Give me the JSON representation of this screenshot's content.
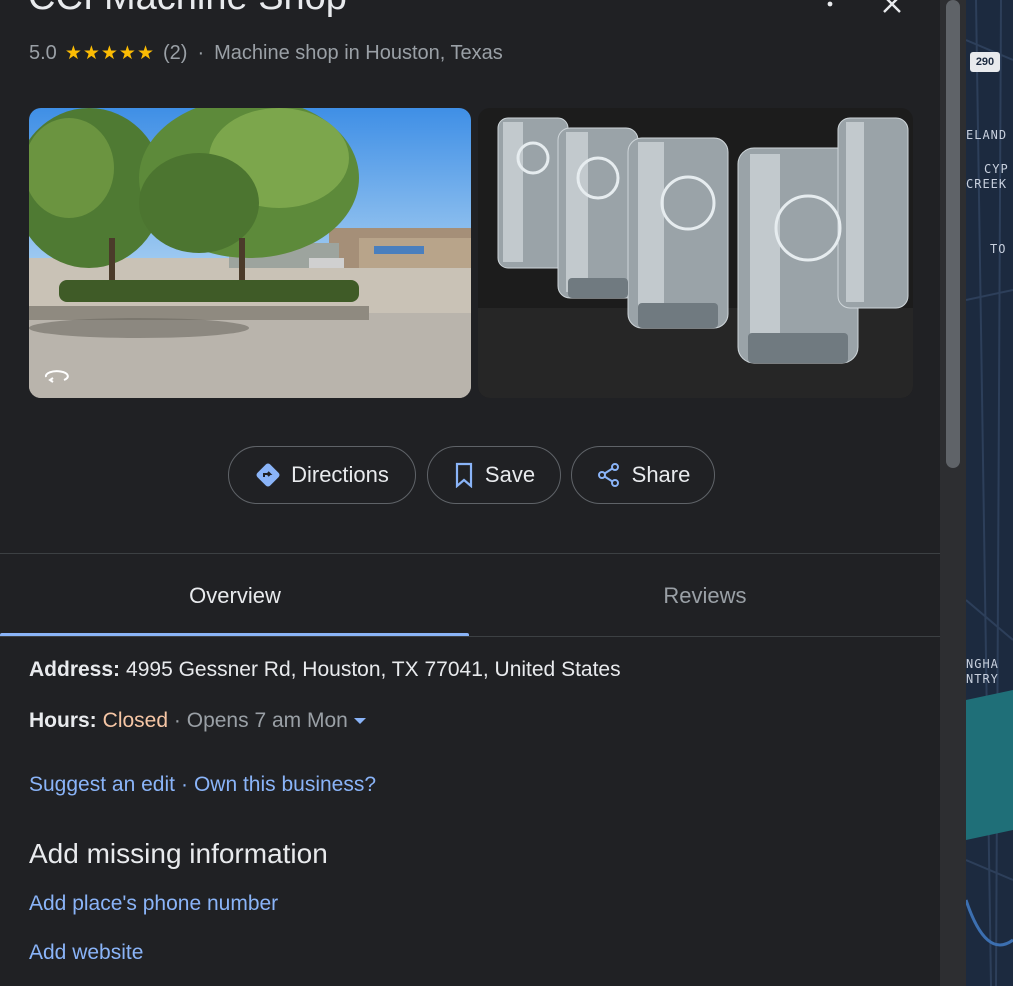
{
  "place": {
    "title": "CCI Machine Shop",
    "rating": "5.0",
    "stars": "★★★★★",
    "review_count": "(2)",
    "separator": "·",
    "category": "Machine shop in Houston, Texas"
  },
  "photos": [
    {
      "name": "street-view-photo",
      "icon": "street-view-360-icon"
    },
    {
      "name": "parts-photo"
    }
  ],
  "actions": {
    "directions_label": "Directions",
    "save_label": "Save",
    "share_label": "Share"
  },
  "tabs": {
    "overview": "Overview",
    "reviews": "Reviews",
    "active": "overview"
  },
  "details": {
    "address_label": "Address:",
    "address_value": "4995 Gessner Rd, Houston, TX 77041, United States",
    "hours_label": "Hours:",
    "hours_status": "Closed",
    "hours_separator": "·",
    "hours_next": "Opens 7 am Mon"
  },
  "links": {
    "suggest_edit": "Suggest an edit",
    "separator": "·",
    "own_business": "Own this business?"
  },
  "missing_info": {
    "heading": "Add missing information",
    "add_phone": "Add place's phone number",
    "add_website": "Add website"
  },
  "map": {
    "route_shield": "290",
    "labels": [
      "ELAND",
      "CYP",
      "CREEK",
      "TO",
      "NGHA",
      "NTRY"
    ]
  },
  "colors": {
    "background": "#202124",
    "link": "#8ab4f8",
    "star": "#fbbc04",
    "closed": "#f6c6a5",
    "accent_underline": "#8ab4f8"
  }
}
